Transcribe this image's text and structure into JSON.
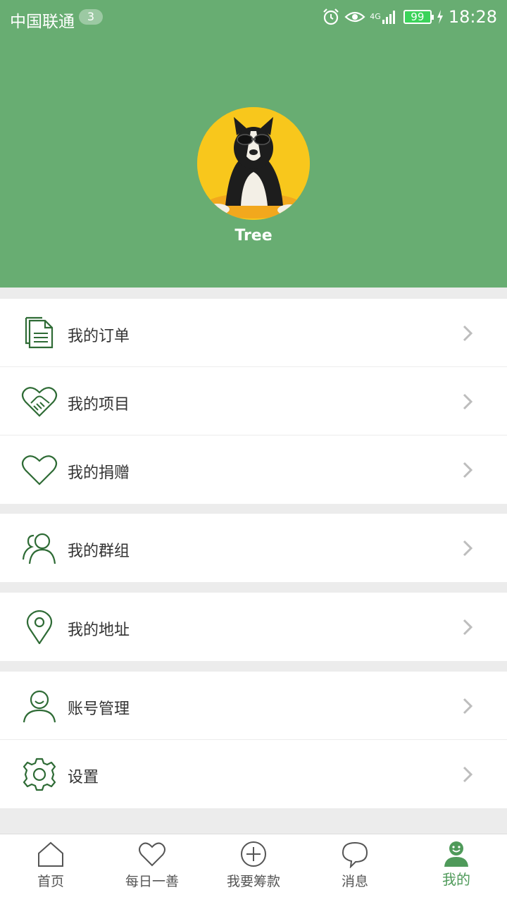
{
  "status_bar": {
    "carrier": "中国联通",
    "sim_badge": "3",
    "network": "4G",
    "battery": "99",
    "time": "18:28"
  },
  "profile": {
    "username": "Tree"
  },
  "menu": {
    "group1": [
      {
        "label": "我的订单",
        "icon": "document-icon"
      },
      {
        "label": "我的项目",
        "icon": "handshake-heart-icon"
      },
      {
        "label": "我的捐赠",
        "icon": "heart-icon"
      }
    ],
    "group2": [
      {
        "label": "我的群组",
        "icon": "group-icon"
      }
    ],
    "group3": [
      {
        "label": "我的地址",
        "icon": "location-pin-icon"
      }
    ],
    "group4": [
      {
        "label": "账号管理",
        "icon": "user-icon"
      },
      {
        "label": "设置",
        "icon": "gear-icon"
      }
    ]
  },
  "tabbar": {
    "tabs": [
      {
        "label": "首页",
        "icon": "home-icon"
      },
      {
        "label": "每日一善",
        "icon": "heart-icon"
      },
      {
        "label": "我要筹款",
        "icon": "plus-circle-icon"
      },
      {
        "label": "消息",
        "icon": "chat-bubble-icon"
      },
      {
        "label": "我的",
        "icon": "smiley-user-icon"
      }
    ],
    "active_index": 4
  },
  "colors": {
    "header": "#68ad72",
    "icon_stroke": "#2e6b35",
    "active_tab": "#4f9a5a"
  }
}
